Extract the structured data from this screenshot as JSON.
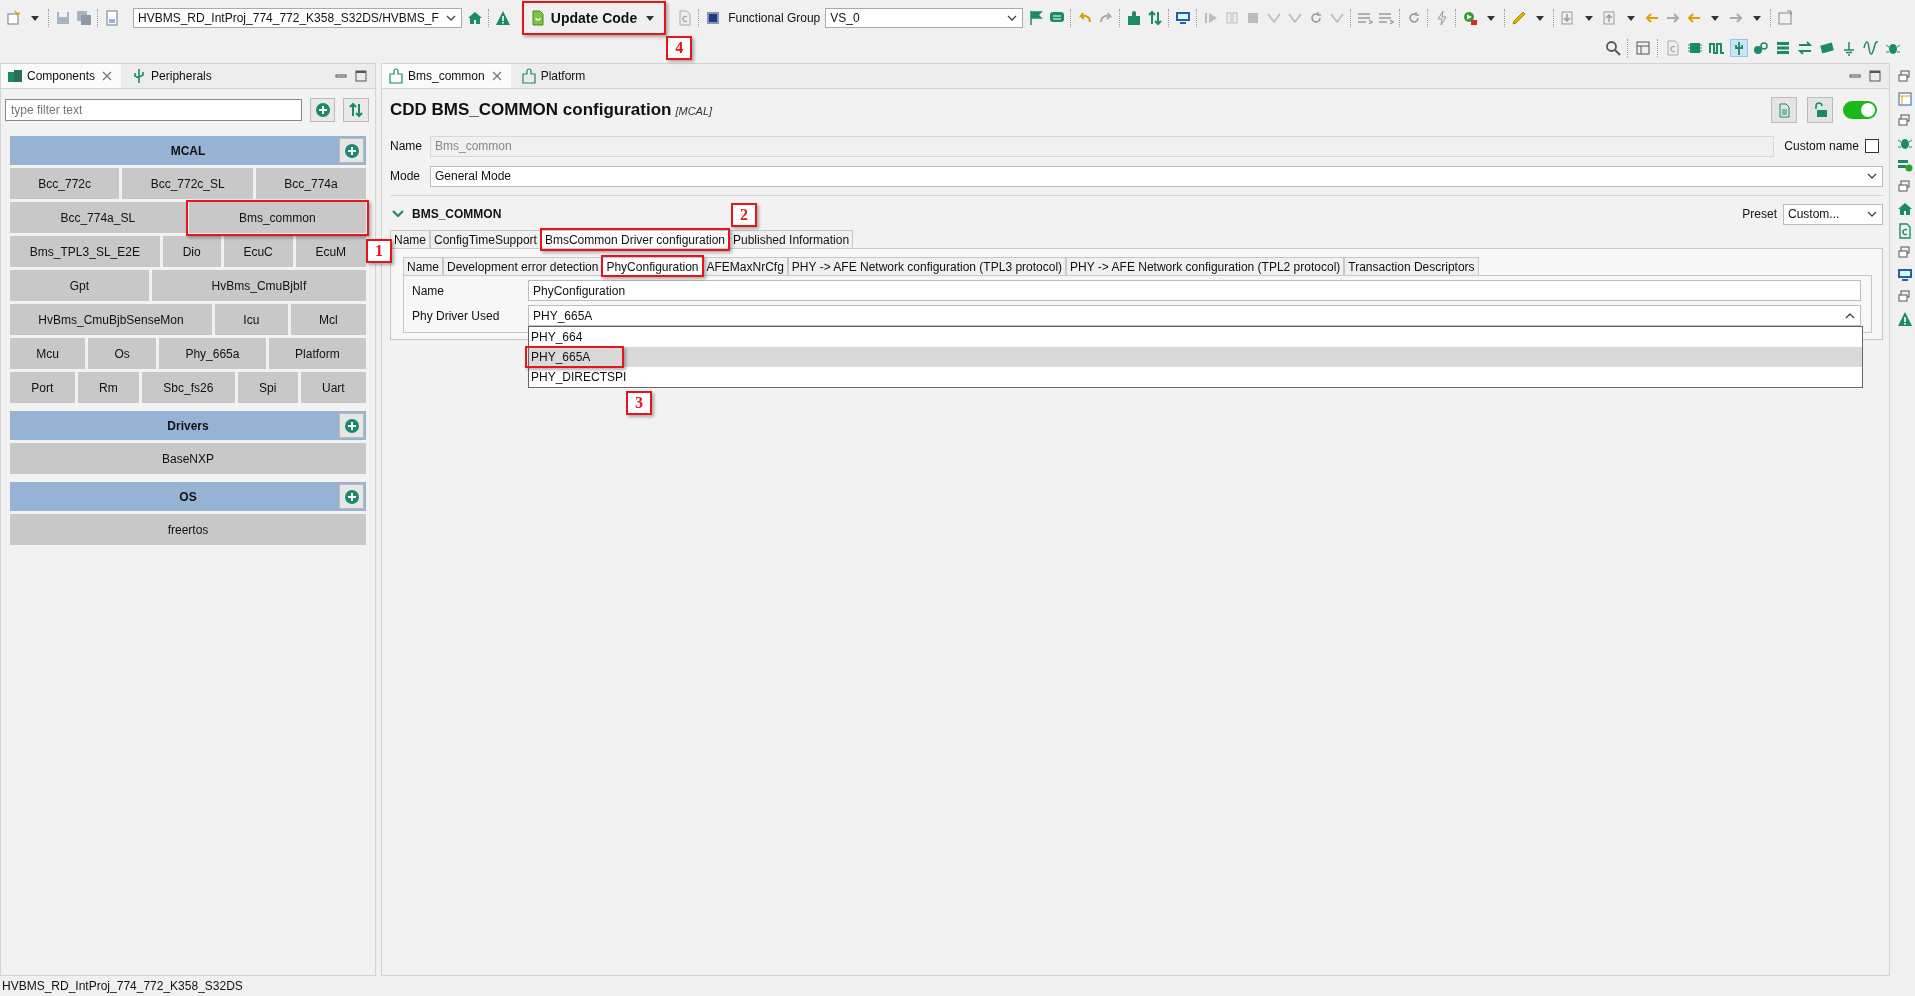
{
  "toolbar": {
    "project": "HVBMS_RD_IntProj_774_772_K358_S32DS/HVBMS_F",
    "update_button": "Update Code",
    "functional_group_label": "Functional Group",
    "functional_group": "VS_0"
  },
  "left_panel": {
    "tabs": [
      {
        "label": "Components",
        "selected": true,
        "closable": true
      },
      {
        "label": "Peripherals",
        "selected": false,
        "closable": false
      }
    ],
    "filter": {
      "placeholder": "type filter text"
    },
    "categories": [
      {
        "title": "MCAL",
        "rows": [
          [
            "Bcc_772c",
            "Bcc_772c_SL",
            "Bcc_774a"
          ],
          [
            "Bcc_774a_SL",
            "Bms_common"
          ],
          [
            "Bms_TPL3_SL_E2E",
            "Dio",
            "EcuC",
            "EcuM"
          ],
          [
            "Gpt",
            "HvBms_CmuBjbIf"
          ],
          [
            "HvBms_CmuBjbSenseMon",
            "Icu",
            "Mcl"
          ],
          [
            "Mcu",
            "Os",
            "Phy_665a",
            "Platform"
          ],
          [
            "Port",
            "Rm",
            "Sbc_fs26",
            "Spi",
            "Uart"
          ]
        ]
      },
      {
        "title": "Drivers",
        "rows": [
          [
            "BaseNXP"
          ]
        ]
      },
      {
        "title": "OS",
        "rows": [
          [
            "freertos"
          ]
        ]
      }
    ]
  },
  "editor": {
    "tabs": [
      {
        "label": "Bms_common",
        "selected": true,
        "closable": true
      },
      {
        "label": "Platform",
        "selected": false,
        "closable": false
      }
    ],
    "title": "CDD BMS_COMMON configuration",
    "title_tag": "[MCAL]",
    "enabled": true,
    "name_label": "Name",
    "name_value": "Bms_common",
    "custom_name_label": "Custom name",
    "custom_name_checked": false,
    "mode_label": "Mode",
    "mode_value": "General Mode",
    "section": {
      "title": "BMS_COMMON",
      "expanded": true,
      "preset_label": "Preset",
      "preset_value": "Custom...",
      "tabs": [
        {
          "label": "Name",
          "selected": false
        },
        {
          "label": "ConfigTimeSupport",
          "selected": false
        },
        {
          "label": "BmsCommon Driver configuration",
          "selected": true
        },
        {
          "label": "Published Information",
          "selected": false
        }
      ],
      "subtabs": [
        {
          "label": "Name",
          "selected": false
        },
        {
          "label": "Development error detection",
          "selected": false
        },
        {
          "label": "PhyConfiguration",
          "selected": true
        },
        {
          "label": "AFEMaxNrCfg",
          "selected": false
        },
        {
          "label": "PHY -> AFE Network configuration (TPL3 protocol)",
          "selected": false
        },
        {
          "label": "PHY -> AFE Network configuration (TPL2 protocol)",
          "selected": false
        },
        {
          "label": "Transaction Descriptors",
          "selected": false
        }
      ],
      "fields": [
        {
          "kind": "text",
          "label": "Name",
          "value": "PhyConfiguration"
        },
        {
          "kind": "combo",
          "label": "Phy Driver Used",
          "value": "PHY_665A",
          "open": true,
          "options": [
            {
              "label": "PHY_664",
              "selected": false
            },
            {
              "label": "PHY_665A",
              "selected": true
            },
            {
              "label": "PHY_DIRECTSPI",
              "selected": false
            }
          ]
        }
      ]
    }
  },
  "callouts": [
    {
      "label": "1"
    },
    {
      "label": "2"
    },
    {
      "label": "3"
    },
    {
      "label": "4"
    }
  ],
  "status_bar": {
    "text": "HVBMS_RD_IntProj_774_772_K358_S32DS"
  }
}
